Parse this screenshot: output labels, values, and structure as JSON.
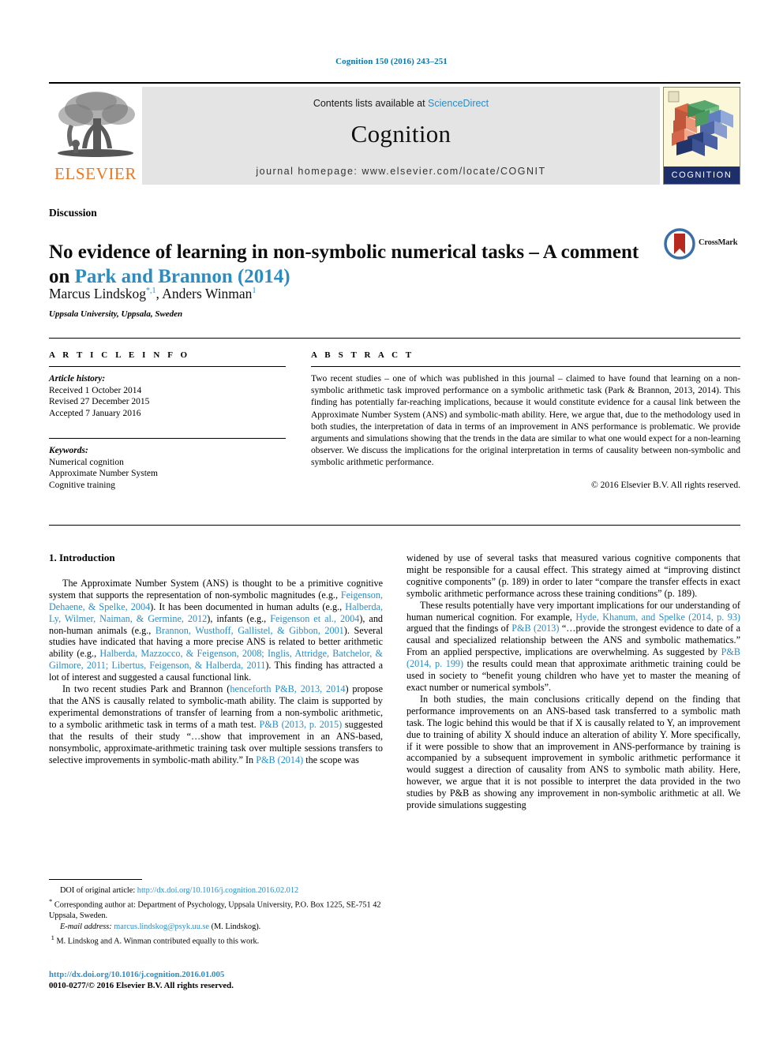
{
  "running_head": "Cognition 150 (2016) 243–251",
  "masthead": {
    "elsevier_wordmark": "ELSEVIER",
    "contents_prefix": "Contents lists available at ",
    "contents_link": "ScienceDirect",
    "journal_title": "Cognition",
    "homepage": "journal homepage: www.elsevier.com/locate/COGNIT",
    "cover_wordmark": "COGNITION"
  },
  "article": {
    "type": "Discussion",
    "title_part1": "No evidence of learning in non-symbolic numerical tasks – A comment on ",
    "title_link": "Park and Brannon (2014)",
    "crossmark_label": "CrossMark",
    "authors": "Marcus Lindskog",
    "author_sup1": "*,1",
    "authors_2": ", Anders Winman",
    "author_sup2": "1",
    "affiliation": "Uppsala University, Uppsala, Sweden"
  },
  "info": {
    "heading": "A R T I C L E   I N F O",
    "history_label": "Article history:",
    "history": [
      "Received 1 October 2014",
      "Revised 27 December 2015",
      "Accepted 7 January 2016"
    ],
    "keywords_label": "Keywords:",
    "keywords": [
      "Numerical cognition",
      "Approximate Number System",
      "Cognitive training"
    ]
  },
  "abstract": {
    "heading": "A B S T R A C T",
    "text": "Two recent studies – one of which was published in this journal – claimed to have found that learning on a non-symbolic arithmetic task improved performance on a symbolic arithmetic task (Park & Brannon, 2013, 2014). This finding has potentially far-reaching implications, because it would constitute evidence for a causal link between the Approximate Number System (ANS) and symbolic-math ability. Here, we argue that, due to the methodology used in both studies, the interpretation of data in terms of an improvement in ANS performance is problematic. We provide arguments and simulations showing that the trends in the data are similar to what one would expect for a non-learning observer. We discuss the implications for the original interpretation in terms of causality between non-symbolic and symbolic arithmetic performance.",
    "copyright": "© 2016 Elsevier B.V. All rights reserved."
  },
  "body": {
    "section_heading": "1. Introduction",
    "left_paragraphs": [
      {
        "segments": [
          {
            "t": "The Approximate Number System (ANS) is thought to be a primitive cognitive system that supports the representation of non-symbolic magnitudes (e.g., ",
            "link": false
          },
          {
            "t": "Feigenson, Dehaene, & Spelke, 2004",
            "link": true
          },
          {
            "t": "). It has been documented in human adults (e.g., ",
            "link": false
          },
          {
            "t": "Halberda, Ly, Wilmer, Naiman, & Germine, 2012",
            "link": true
          },
          {
            "t": "), infants (e.g., ",
            "link": false
          },
          {
            "t": "Feigenson et al., 2004",
            "link": true
          },
          {
            "t": "), and non-human animals (e.g., ",
            "link": false
          },
          {
            "t": "Brannon, Wusthoff, Gallistel, & Gibbon, 2001",
            "link": true
          },
          {
            "t": "). Several studies have indicated that having a more precise ANS is related to better arithmetic ability (e.g., ",
            "link": false
          },
          {
            "t": "Halberda, Mazzocco, & Feigenson, 2008; Inglis, Attridge, Batchelor, & Gilmore, 2011; Libertus, Feigenson, & Halberda, 2011",
            "link": true
          },
          {
            "t": "). This finding has attracted a lot of interest and suggested a causal functional link.",
            "link": false
          }
        ]
      },
      {
        "segments": [
          {
            "t": "In two recent studies Park and Brannon (",
            "link": false
          },
          {
            "t": "henceforth P&B, 2013, 2014",
            "link": true
          },
          {
            "t": ") propose that the ANS is causally related to symbolic-math ability. The claim is supported by experimental demonstrations of transfer of learning from a non-symbolic arithmetic, to a symbolic arithmetic task in terms of a math test. ",
            "link": false
          },
          {
            "t": "P&B (2013, p. 2015)",
            "link": true
          },
          {
            "t": " suggested that the results of their study “…show that improvement in an ANS-based, nonsymbolic, approximate-arithmetic training task over multiple sessions transfers to selective improvements in symbolic-math ability.” In ",
            "link": false
          },
          {
            "t": "P&B (2014)",
            "link": true
          },
          {
            "t": " the scope was",
            "link": false
          }
        ]
      }
    ],
    "right_paragraphs": [
      {
        "segments": [
          {
            "t": "widened by use of several tasks that measured various cognitive components that might be responsible for a causal effect. This strategy aimed at “improving distinct cognitive components” (p. 189) in order to later “compare the transfer effects in exact symbolic arithmetic performance across these training conditions” (p. 189).",
            "link": false
          }
        ],
        "noindent": true
      },
      {
        "segments": [
          {
            "t": "These results potentially have very important implications for our understanding of human numerical cognition. For example, ",
            "link": false
          },
          {
            "t": "Hyde, Khanum, and Spelke (2014, p. 93)",
            "link": true
          },
          {
            "t": " argued that the findings of ",
            "link": false
          },
          {
            "t": "P&B (2013)",
            "link": true
          },
          {
            "t": " “…provide the strongest evidence to date of a causal and specialized relationship between the ANS and symbolic mathematics.” From an applied perspective, implications are overwhelming. As suggested by ",
            "link": false
          },
          {
            "t": "P&B (2014, p. 199)",
            "link": true
          },
          {
            "t": " the results could mean that approximate arithmetic training could be used in society to “benefit young children who have yet to master the meaning of exact number or numerical symbols”.",
            "link": false
          }
        ]
      },
      {
        "segments": [
          {
            "t": "In both studies, the main conclusions critically depend on the finding that performance improvements on an ANS-based task transferred to a symbolic math task. The logic behind this would be that if X is causally related to Y, an improvement due to training of ability X should induce an alteration of ability Y. More specifically, if it were possible to show that an improvement in ANS-performance by training is accompanied by a subsequent improvement in symbolic arithmetic performance it would suggest a direction of causality from ANS to symbolic math ability. Here, however, we argue that it is not possible to interpret the data provided in the two studies by P&B as showing any improvement in non-symbolic arithmetic at all. We provide simulations suggesting",
            "link": false
          }
        ]
      }
    ]
  },
  "footnotes": {
    "doi_label": "DOI of original article: ",
    "doi_link": "http://dx.doi.org/10.1016/j.cognition.2016.02.012",
    "corresponding": "Corresponding author at: Department of Psychology, Uppsala University, P.O. Box 1225, SE-751 42 Uppsala, Sweden.",
    "email_label": "E-mail address: ",
    "email_link": "marcus.lindskog@psyk.uu.se",
    "email_suffix": " (M. Lindskog).",
    "equal_contrib": "M. Lindskog and A. Winman contributed equally to this work.",
    "marker_star": "*",
    "marker_one": "1"
  },
  "imprint": {
    "doi": "http://dx.doi.org/10.1016/j.cognition.2016.01.005",
    "issn_line": "0010-0277/© 2016 Elsevier B.V. All rights reserved."
  },
  "colors": {
    "link": "#2b8cc4",
    "running_head": "#0a76a8",
    "elsevier_orange": "#e87722",
    "banner_gray": "#e4e4e4",
    "cover_navy": "#1c2f6b"
  }
}
